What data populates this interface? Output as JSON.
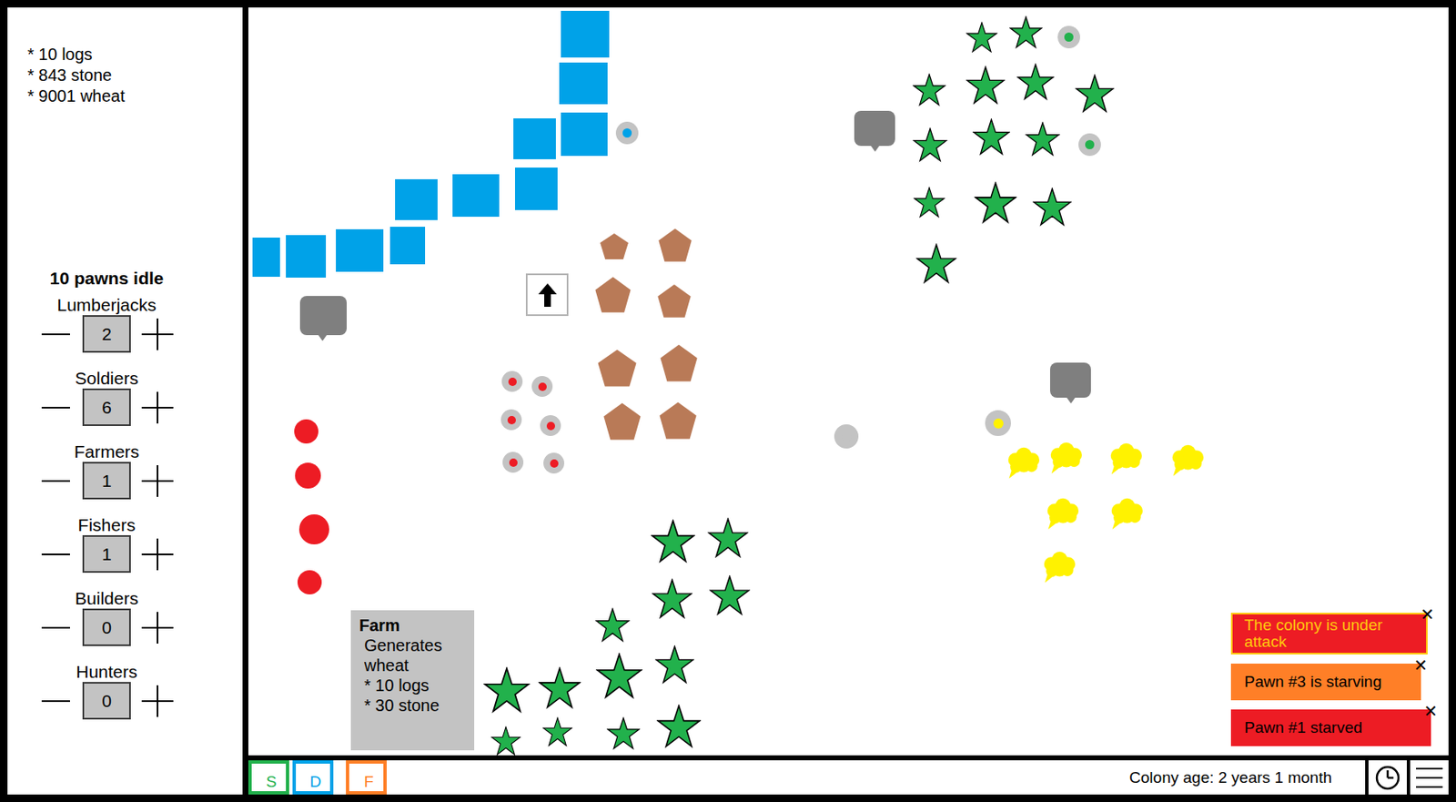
{
  "resources": [
    "* 10 logs",
    "* 843 stone",
    "* 9001 wheat"
  ],
  "workforce": {
    "idle": "10 pawns idle",
    "jobs": [
      {
        "name": "Lumberjacks",
        "count": "2"
      },
      {
        "name": "Soldiers",
        "count": "6"
      },
      {
        "name": "Farmers",
        "count": "1"
      },
      {
        "name": "Fishers",
        "count": "1"
      },
      {
        "name": "Builders",
        "count": "0"
      },
      {
        "name": "Hunters",
        "count": "0"
      }
    ]
  },
  "map": {
    "pawns": [
      {
        "color": "#ed1c24"
      },
      {
        "color": "#ed1c24"
      },
      {
        "color": "#ed1c24"
      },
      {
        "color": "#ed1c24"
      },
      {
        "color": "#ed1c24"
      },
      {
        "color": "#ed1c24"
      },
      {
        "color": "#00a2e8"
      },
      {
        "color": "#22b14c"
      },
      {
        "color": "#22b14c"
      },
      {
        "color": "#fff200"
      },
      {
        "color": "#c3c3c3"
      }
    ]
  },
  "tooltip": {
    "title": "Farm",
    "description": "Generates wheat",
    "costs": [
      "* 10 logs",
      "* 30 stone"
    ]
  },
  "notifications": [
    {
      "text": "The colony is under attack",
      "color": "#ed1c24",
      "text_color": "#ffc90e",
      "close": "✕"
    },
    {
      "text": "Pawn #3 is starving",
      "color": "#ff7f27",
      "text_color": "#000000",
      "close": "✕"
    },
    {
      "text": "Pawn #1 starved",
      "color": "#ed1c24",
      "text_color": "#000000",
      "close": "✕"
    }
  ],
  "bottom_bar": {
    "buttons": [
      {
        "label": "S",
        "color": "#22b14c"
      },
      {
        "label": "D",
        "color": "#00a2e8"
      },
      {
        "label": "F",
        "color": "#ff7f27"
      }
    ],
    "colony_age": "Colony age: 2 years 1 month"
  }
}
